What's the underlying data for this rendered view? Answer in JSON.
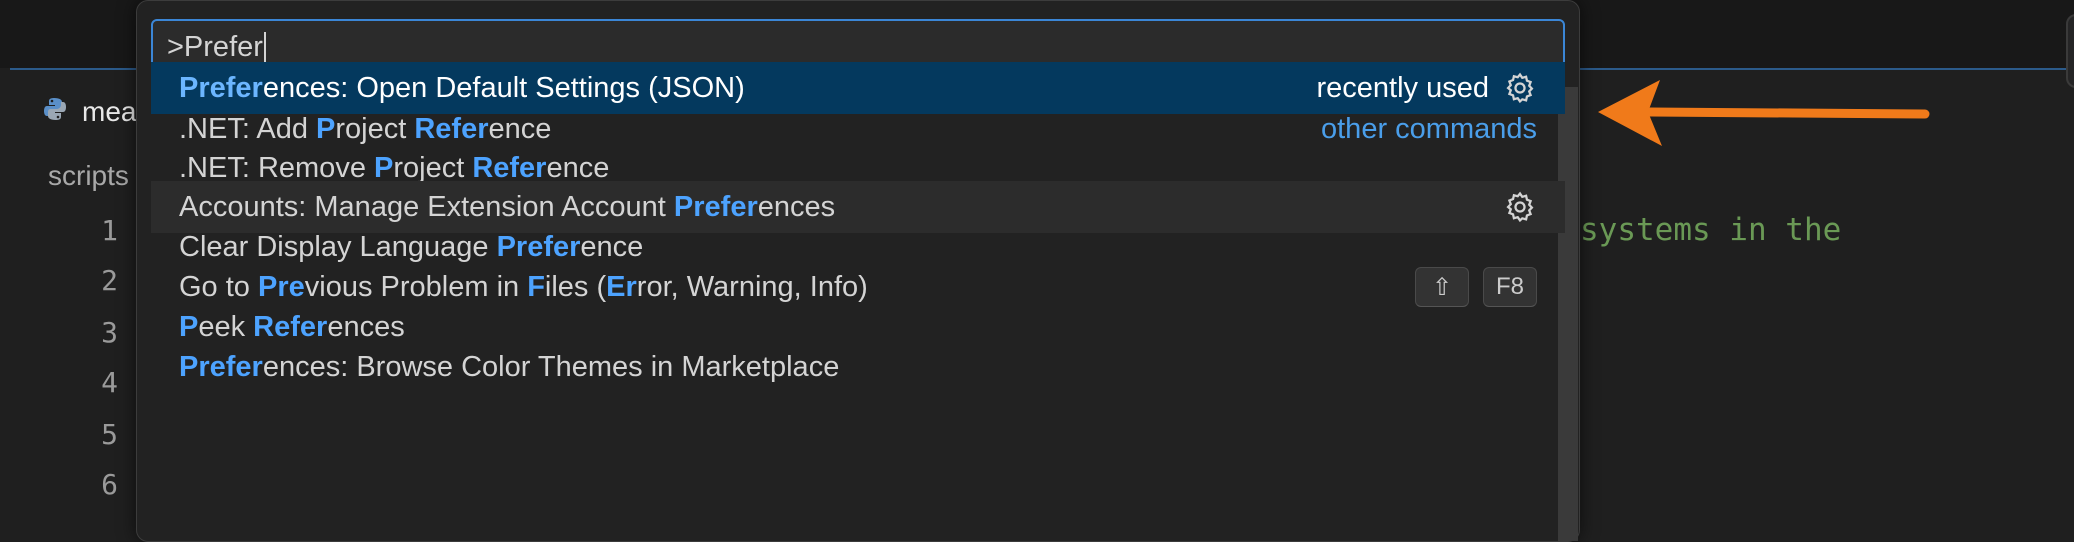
{
  "editor": {
    "tab_label": "mea",
    "breadcrumb": "scripts",
    "line_numbers": [
      "1",
      "2",
      "3",
      "4",
      "5",
      "6"
    ],
    "code_fragment": "systems in the"
  },
  "palette": {
    "input_value": ">Prefer",
    "items": [
      {
        "parts": [
          {
            "t": "Prefer",
            "h": true
          },
          {
            "t": "ences: Open Default Settings (JSON)",
            "h": false
          }
        ],
        "meta": "recently used",
        "gear": true,
        "selected": true
      },
      {
        "parts": [
          {
            "t": ".NET: Add ",
            "h": false
          },
          {
            "t": "P",
            "h": true
          },
          {
            "t": "roject ",
            "h": false
          },
          {
            "t": "Refer",
            "h": true
          },
          {
            "t": "ence",
            "h": false
          }
        ],
        "link": "other commands"
      },
      {
        "parts": [
          {
            "t": ".NET: Remove ",
            "h": false
          },
          {
            "t": "P",
            "h": true
          },
          {
            "t": "roject ",
            "h": false
          },
          {
            "t": "Refer",
            "h": true
          },
          {
            "t": "ence",
            "h": false
          }
        ]
      },
      {
        "parts": [
          {
            "t": "Accounts: Manage Extension Account ",
            "h": false
          },
          {
            "t": "Prefer",
            "h": true
          },
          {
            "t": "ences",
            "h": false
          }
        ],
        "gear": true,
        "hover": true
      },
      {
        "parts": [
          {
            "t": "Clear Display Language ",
            "h": false
          },
          {
            "t": "Prefer",
            "h": true
          },
          {
            "t": "ence",
            "h": false
          }
        ]
      },
      {
        "parts": [
          {
            "t": "Go to ",
            "h": false
          },
          {
            "t": "Pre",
            "h": true
          },
          {
            "t": "vious Problem in ",
            "h": false
          },
          {
            "t": "F",
            "h": true
          },
          {
            "t": "iles (",
            "h": false
          },
          {
            "t": "Er",
            "h": true
          },
          {
            "t": "ror, Warning, Info)",
            "h": false
          }
        ],
        "keys": [
          "⇧",
          "F8"
        ]
      },
      {
        "parts": [
          {
            "t": "P",
            "h": true
          },
          {
            "t": "eek ",
            "h": false
          },
          {
            "t": "Refer",
            "h": true
          },
          {
            "t": "ences",
            "h": false
          }
        ]
      },
      {
        "parts": [
          {
            "t": "Prefer",
            "h": true
          },
          {
            "t": "ences: Browse Color Themes in Marketplace",
            "h": false
          }
        ]
      }
    ]
  },
  "colors": {
    "highlight": "#4da3ff",
    "selection_bg": "#04395e",
    "focus_border": "#3b86d6",
    "annotation_arrow": "#f07a1a",
    "comment_green": "#6a9955"
  },
  "icons": {
    "file_icon": "python-icon",
    "row_action": "gear-icon",
    "annotation": "arrow-left-icon"
  }
}
